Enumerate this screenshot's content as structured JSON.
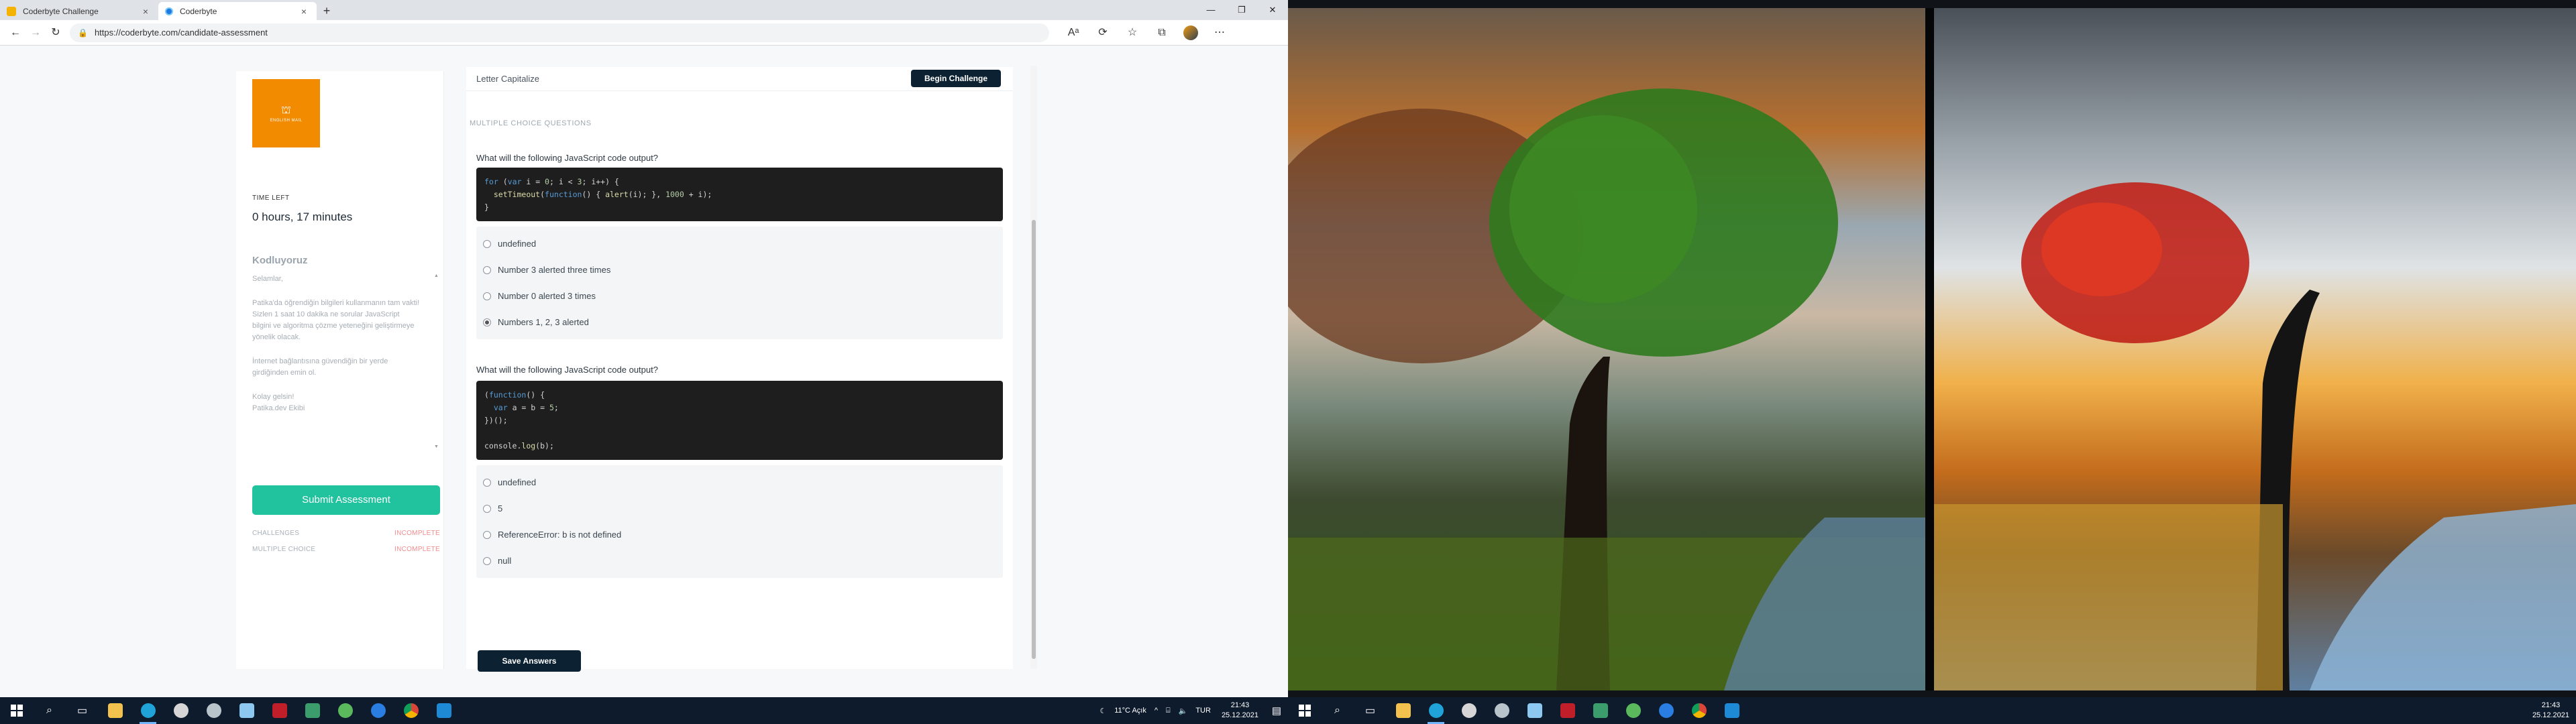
{
  "browser": {
    "tabs": [
      {
        "title": "Coderbyte Challenge",
        "close": "×",
        "active": false
      },
      {
        "title": "Coderbyte",
        "close": "×",
        "active": true
      }
    ],
    "new_tab": "+",
    "window_controls": [
      "—",
      "❐",
      "✕"
    ],
    "address": "https://coderbyte.com/candidate-assessment",
    "nav": {
      "back": "←",
      "forward": "→",
      "reload": "↻"
    },
    "toolbar_icons": [
      "font-icon",
      "refresh-icon",
      "favorites-icon",
      "collections-icon",
      "extensions-icon",
      "more-icon"
    ]
  },
  "sidebar": {
    "logo_text": "ENGLISH MAIL",
    "time_left_label": "TIME LEFT",
    "time_left_value": "0 hours, 17 minutes",
    "title": "Kodluyoruz",
    "paragraphs": [
      "Selamlar,",
      "Patika'da öğrendiğin bilgileri kullanmanın tam vakti! Sizlen 1 saat 10 dakika ne sorular JavaScript bilgini ve algoritma çözme yeteneğini geliştirmeye yönelik olacak.",
      "İnternet bağlantısına güvendiğin bir yerde girdiğinden emin ol.",
      "Kolay gelsin!\nPatika.dev Ekibi"
    ],
    "submit_label": "Submit Assessment",
    "status": [
      {
        "name": "CHALLENGES",
        "value": "INCOMPLETE"
      },
      {
        "name": "MULTIPLE CHOICE",
        "value": "INCOMPLETE"
      }
    ]
  },
  "main": {
    "challenge_name": "Letter Capitalize",
    "begin_label": "Begin Challenge",
    "mc_header": "MULTIPLE CHOICE QUESTIONS",
    "questions": [
      {
        "text": "What will the following JavaScript code output?",
        "options": [
          "undefined",
          "Number 3 alerted three times",
          "Number 0 alerted 3 times",
          "Numbers 1, 2, 3 alerted"
        ],
        "selected": 3
      },
      {
        "text": "What will the following JavaScript code output?",
        "options": [
          "undefined",
          "5",
          "ReferenceError: b is not defined",
          "null"
        ],
        "selected": -1
      }
    ],
    "save_label": "Save Answers"
  },
  "taskbar_left": {
    "weather": "11°C  Açık",
    "lang": "TUR",
    "time": "21:43",
    "date": "25.12.2021"
  },
  "taskbar_right": {
    "time": "21:43",
    "date": "25.12.2021"
  },
  "colors": {
    "accent_green": "#21c29e",
    "dark_button": "#0c2233",
    "incomplete_red": "#f08c8c",
    "logo_orange": "#f28b00",
    "taskbar": "#0e1b2d"
  }
}
